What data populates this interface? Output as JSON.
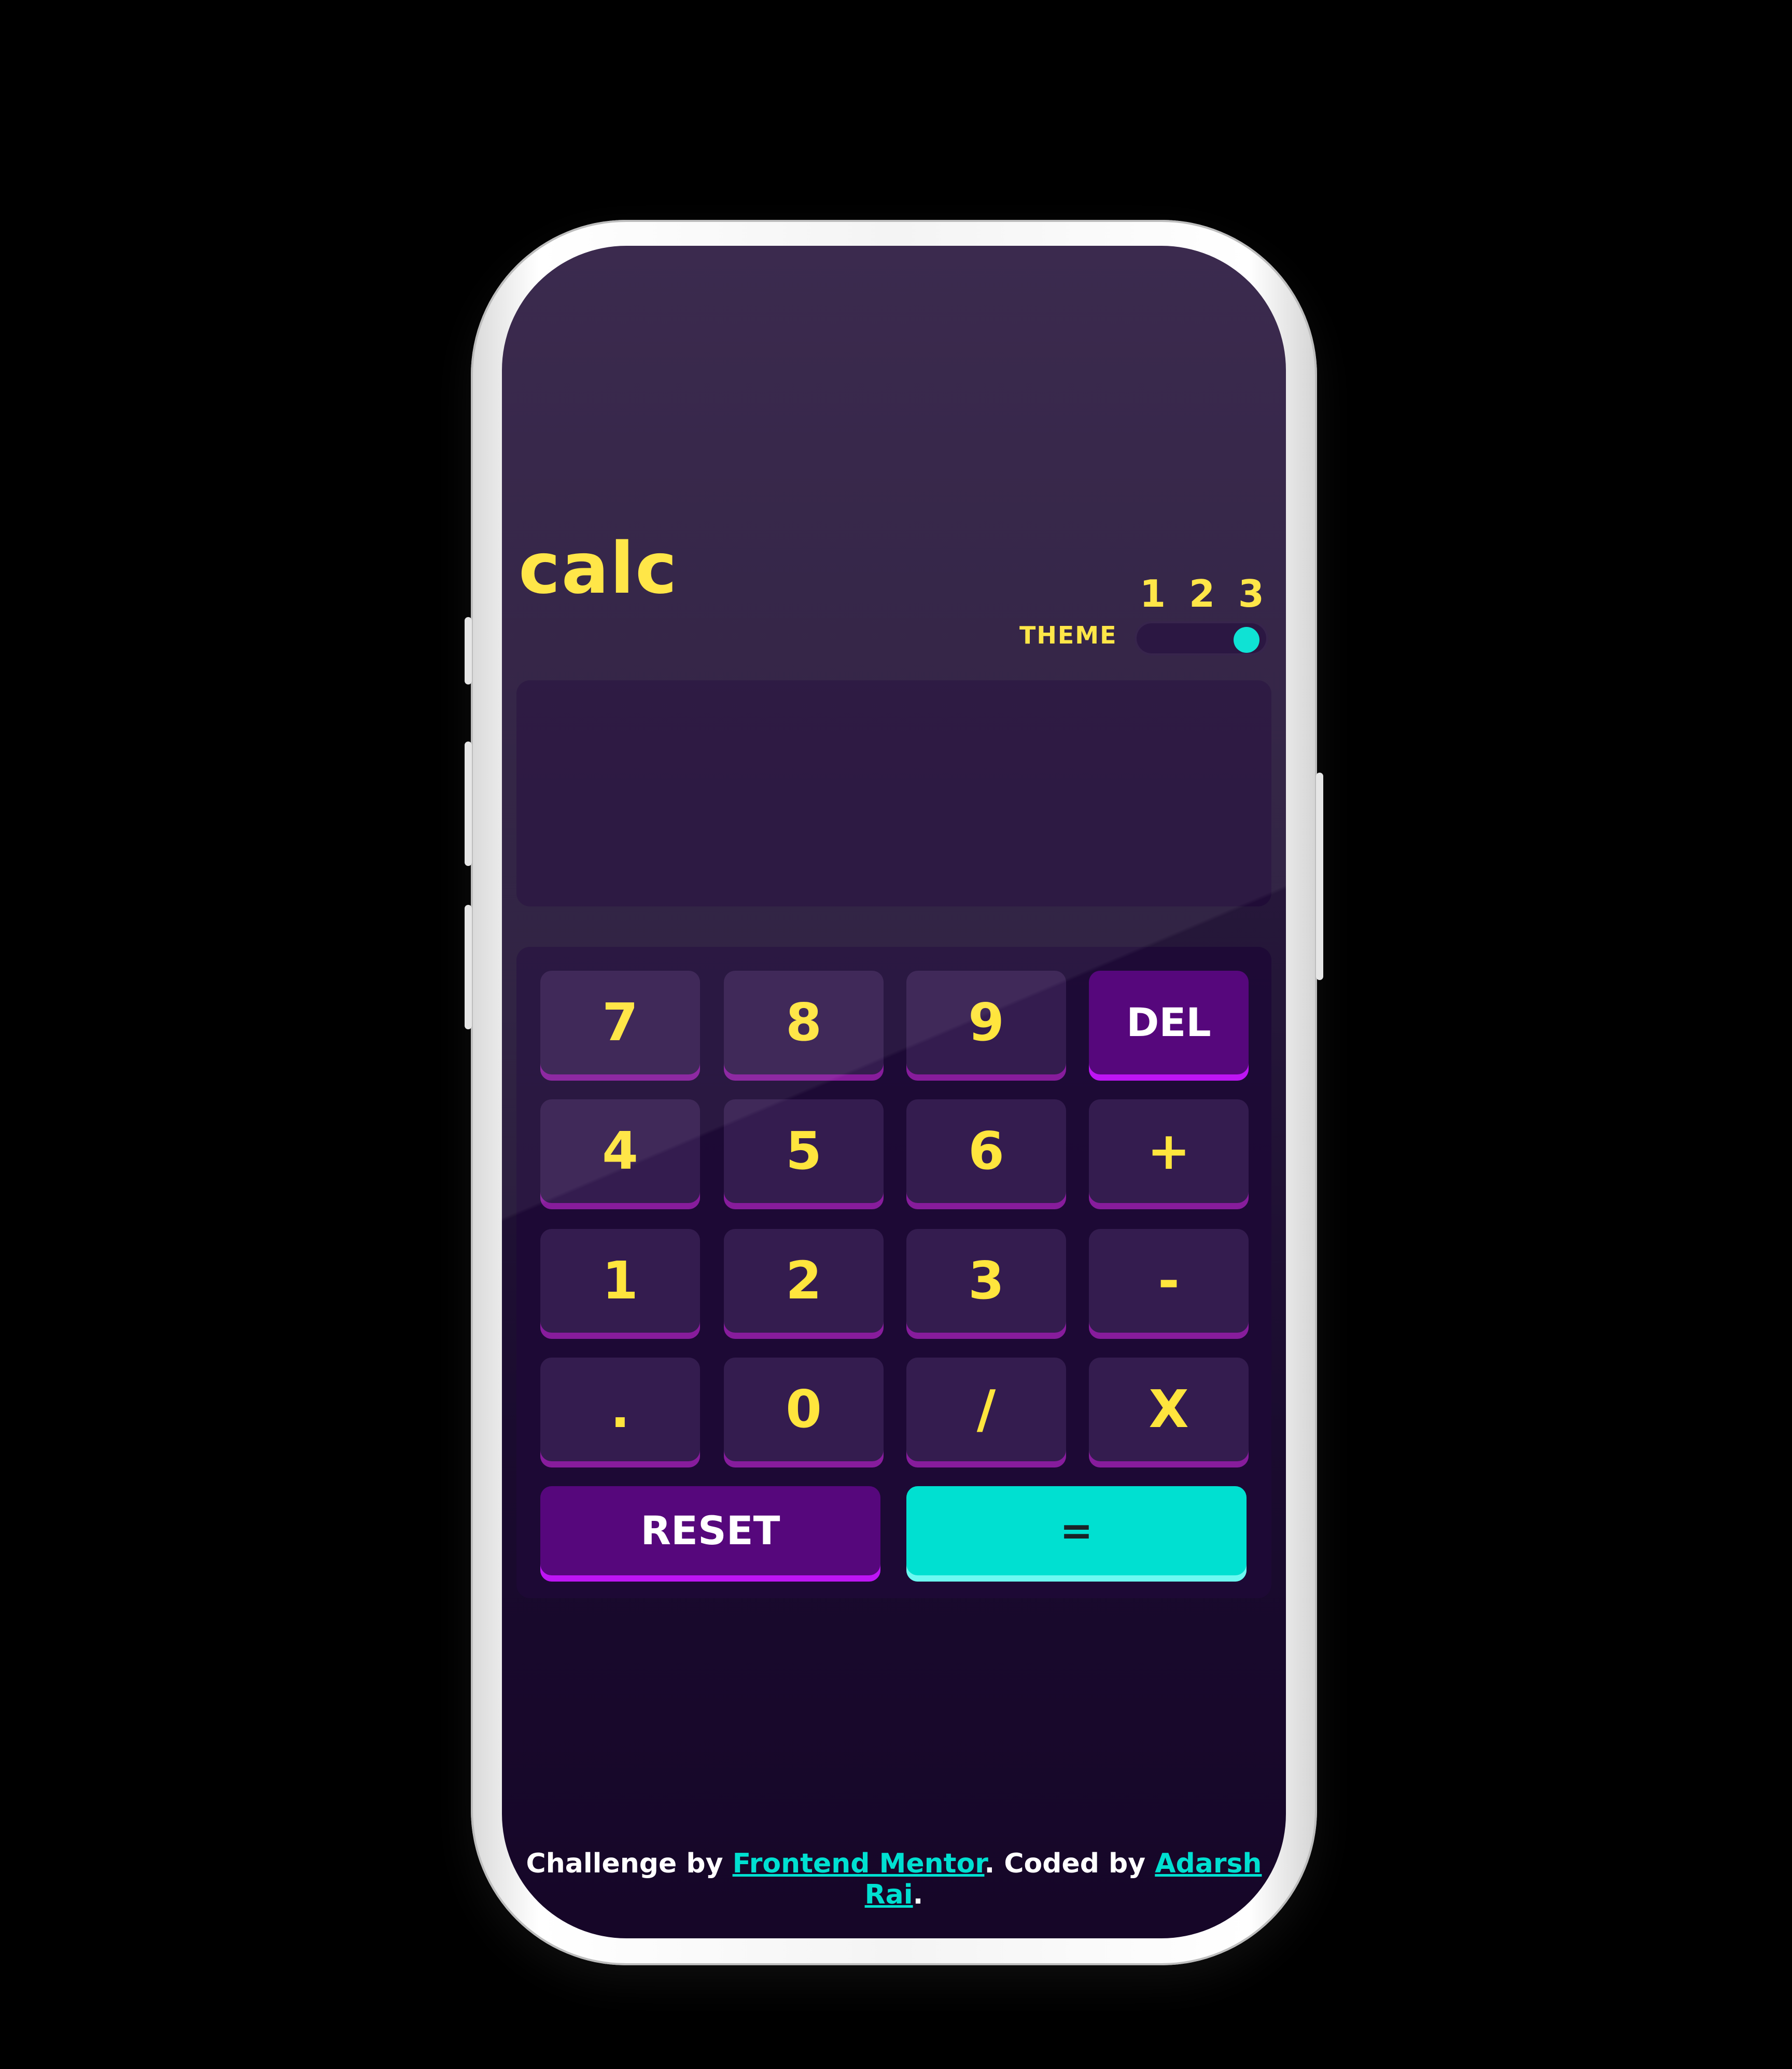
{
  "app": {
    "logo": "calc"
  },
  "theme": {
    "label": "THEME",
    "options": [
      "1",
      "2",
      "3"
    ],
    "selected": "3"
  },
  "display": {
    "value": ""
  },
  "keys": {
    "row1": [
      "7",
      "8",
      "9",
      "DEL"
    ],
    "row2": [
      "4",
      "5",
      "6",
      "+"
    ],
    "row3": [
      "1",
      "2",
      "3",
      "-"
    ],
    "row4": [
      ".",
      "0",
      "/",
      "X"
    ],
    "reset": "RESET",
    "equals": "="
  },
  "footer": {
    "prefix": "Challenge by ",
    "link1": "Frontend Mentor",
    "middle": ". Coded by ",
    "link2": "Adarsh Rai",
    "suffix": "."
  },
  "colors": {
    "accent_yellow": "#ffe53d",
    "accent_cyan": "#00e0d1",
    "key_purple": "#56077c",
    "key_bg": "#341c4f",
    "screen_bg": "#160628"
  }
}
